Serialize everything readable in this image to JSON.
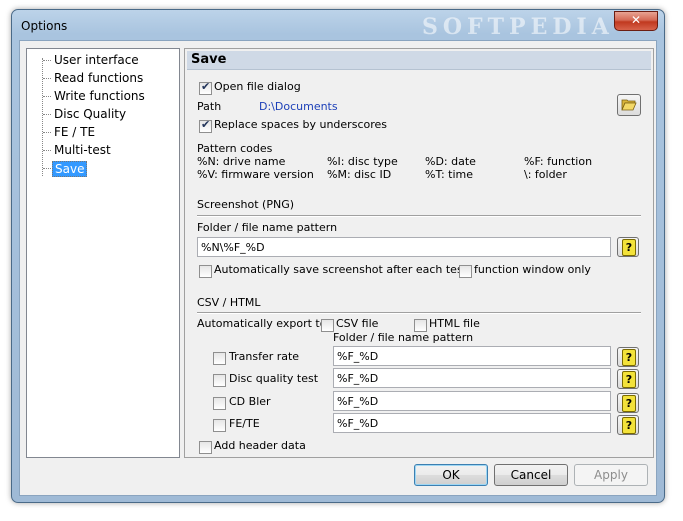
{
  "window": {
    "title": "Options",
    "watermark": "SOFTPEDIA",
    "close": "✕"
  },
  "tree": {
    "items": [
      {
        "label": "User interface"
      },
      {
        "label": "Read functions"
      },
      {
        "label": "Write functions"
      },
      {
        "label": "Disc Quality"
      },
      {
        "label": "FE / TE"
      },
      {
        "label": "Multi-test"
      },
      {
        "label": "Save"
      }
    ],
    "selected": "Save"
  },
  "panel": {
    "heading": "Save",
    "open_file_dialog": {
      "label": "Open file dialog",
      "checked": true
    },
    "path": {
      "label": "Path",
      "value": "D:\\Documents"
    },
    "replace_spaces": {
      "label": "Replace spaces by underscores",
      "checked": true
    },
    "pattern_codes": {
      "title": "Pattern codes",
      "codes": [
        "%N: drive name",
        "%I: disc type",
        "%D: date",
        "%F: function",
        "%V: firmware version",
        "%M: disc ID",
        "%T: time",
        "\\: folder"
      ]
    },
    "screenshot": {
      "title": "Screenshot (PNG)",
      "folder_label": "Folder / file name pattern",
      "pattern_value": "%N\\%F_%D",
      "auto_save": {
        "label": "Automatically save screenshot after each test",
        "checked": false
      },
      "function_window_only": {
        "label": "function window only",
        "checked": false
      }
    },
    "csv": {
      "title": "CSV / HTML",
      "auto_export_label": "Automatically export to:",
      "csv_file": {
        "label": "CSV file",
        "checked": false
      },
      "html_file": {
        "label": "HTML file",
        "checked": false
      },
      "folder_label": "Folder / file name pattern",
      "rows": [
        {
          "label": "Transfer rate",
          "value": "%F_%D",
          "checked": false
        },
        {
          "label": "Disc quality test",
          "value": "%F_%D",
          "checked": false
        },
        {
          "label": "CD Bler",
          "value": "%F_%D",
          "checked": false
        },
        {
          "label": "FE/TE",
          "value": "%F_%D",
          "checked": false
        }
      ],
      "add_header": {
        "label": "Add header data",
        "checked": false
      }
    }
  },
  "buttons": {
    "ok": "OK",
    "cancel": "Cancel",
    "apply": "Apply"
  },
  "colors": {
    "selection": "#3399ff",
    "link": "#1c3fb8",
    "heading_bg": "#cfd9e6",
    "close_red": "#c0391f"
  }
}
